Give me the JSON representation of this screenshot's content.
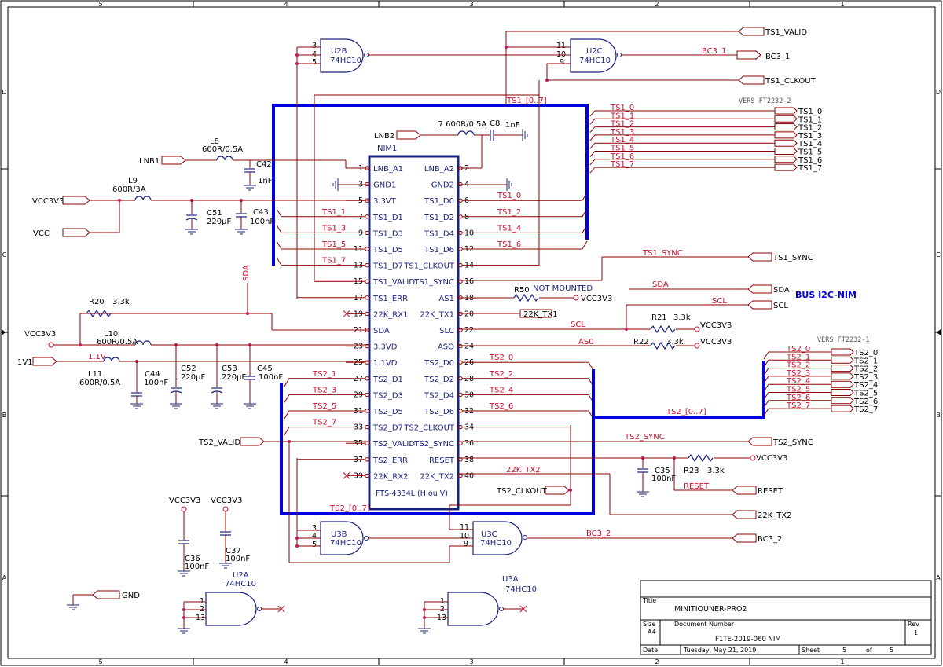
{
  "frame": {
    "cols": [
      "5",
      "4",
      "3",
      "2",
      "1"
    ],
    "rows": [
      "D",
      "C",
      "B",
      "A"
    ]
  },
  "title_block": {
    "title_label": "Title",
    "title": "MINITIOUNER-PRO2",
    "size_label": "Size",
    "size": "A4",
    "docnum_label": "Document Number",
    "docnum": "F1TE-2019-060   NIM",
    "rev_label": "Rev",
    "rev": "1",
    "date_label": "Date:",
    "date": "Tuesday, May 21, 2019",
    "sheet_label": "Sheet",
    "sheet": "5",
    "of_label": "of",
    "sheets": "5"
  },
  "nim": {
    "refdes": "NIM1",
    "part": "FTS-4334L (H ou V)",
    "left_pins": [
      {
        "num": "1",
        "name": "LNB_A1"
      },
      {
        "num": "3",
        "name": "GND1"
      },
      {
        "num": "5",
        "name": "3.3VT"
      },
      {
        "num": "7",
        "name": "TS1_D1"
      },
      {
        "num": "9",
        "name": "TS1_D3"
      },
      {
        "num": "11",
        "name": "TS1_D5"
      },
      {
        "num": "13",
        "name": "TS1_D7"
      },
      {
        "num": "15",
        "name": "TS1_VALID"
      },
      {
        "num": "17",
        "name": "TS1_ERR"
      },
      {
        "num": "19",
        "name": "22K_RX1"
      },
      {
        "num": "21",
        "name": "SDA"
      },
      {
        "num": "23",
        "name": "3.3VD"
      },
      {
        "num": "25",
        "name": "1.1VD"
      },
      {
        "num": "27",
        "name": "TS2_D1"
      },
      {
        "num": "29",
        "name": "TS2_D3"
      },
      {
        "num": "31",
        "name": "TS2_D5"
      },
      {
        "num": "33",
        "name": "TS2_D7"
      },
      {
        "num": "35",
        "name": "TS2_VALID"
      },
      {
        "num": "37",
        "name": "TS2_ERR"
      },
      {
        "num": "39",
        "name": "22K_RX2"
      }
    ],
    "right_pins": [
      {
        "num": "2",
        "name": "LNB_A2"
      },
      {
        "num": "4",
        "name": "GND2"
      },
      {
        "num": "6",
        "name": "TS1_D0"
      },
      {
        "num": "8",
        "name": "TS1_D2"
      },
      {
        "num": "10",
        "name": "TS1_D4"
      },
      {
        "num": "12",
        "name": "TS1_D6"
      },
      {
        "num": "14",
        "name": "TS1_CLKOUT"
      },
      {
        "num": "16",
        "name": "TS1_SYNC"
      },
      {
        "num": "18",
        "name": "AS1"
      },
      {
        "num": "20",
        "name": "22K_TX1"
      },
      {
        "num": "22",
        "name": "SLC"
      },
      {
        "num": "24",
        "name": "ASO"
      },
      {
        "num": "26",
        "name": "TS2_D0"
      },
      {
        "num": "28",
        "name": "TS2_D2"
      },
      {
        "num": "30",
        "name": "TS2_D4"
      },
      {
        "num": "32",
        "name": "TS2_D6"
      },
      {
        "num": "34",
        "name": "TS2_CLKOUT"
      },
      {
        "num": "36",
        "name": "TS2_SYNC"
      },
      {
        "num": "38",
        "name": "RESET"
      },
      {
        "num": "40",
        "name": "22K_TX2"
      }
    ],
    "left_nets": [
      "",
      "",
      "",
      "TS1_1",
      "TS1_3",
      "TS1_5",
      "TS1_7",
      "",
      "",
      "",
      "",
      "",
      "1.1V",
      "TS2_1",
      "TS2_3",
      "TS2_5",
      "TS2_7",
      "",
      "",
      ""
    ],
    "right_nets": [
      "",
      "",
      "TS1_0",
      "TS1_2",
      "TS1_4",
      "TS1_6",
      "",
      "",
      "",
      "",
      "",
      "",
      "TS2_0",
      "TS2_2",
      "TS2_4",
      "TS2_6",
      "",
      "",
      "",
      ""
    ]
  },
  "gates": {
    "u2b": {
      "ref": "U2B",
      "part": "74HC10",
      "pins": [
        "3",
        "4",
        "5"
      ],
      "out": "6"
    },
    "u2c": {
      "ref": "U2C",
      "part": "74HC10",
      "pins": [
        "11",
        "10",
        "9"
      ],
      "out": "8"
    },
    "u3b": {
      "ref": "U3B",
      "part": "74HC10",
      "pins": [
        "3",
        "4",
        "5"
      ],
      "out": "6"
    },
    "u3c": {
      "ref": "U3C",
      "part": "74HC10",
      "pins": [
        "11",
        "10",
        "9"
      ],
      "out": "8"
    },
    "u2a": {
      "ref": "U2A",
      "part": "74HC10",
      "pins": [
        "1",
        "2",
        "13"
      ],
      "out": "12"
    },
    "u3a": {
      "ref": "U3A",
      "part": "74HC10",
      "pins": [
        "1",
        "2",
        "13"
      ],
      "out": "12"
    }
  },
  "components": {
    "l7": "L7 600R/0.5A",
    "c8": "C8",
    "c8_val": "1nF",
    "l8": "L8",
    "l8_val": "600R/0.5A",
    "c42": "C42",
    "c42_val": "1nF",
    "l9": "L9",
    "l9_val": "600R/3A",
    "c51": "C51",
    "c51_val": "220µF",
    "c43": "C43",
    "c43_val": "100nF",
    "r20": "R20",
    "r20_val": "3.3k",
    "l10": "L10",
    "l10_val": "600R/0.5A",
    "l11": "L11",
    "l11_val": "600R/0.5A",
    "c44": "C44",
    "c44_val": "100nF",
    "c52": "C52",
    "c52_val": "220µF",
    "c53": "C53",
    "c53_val": "220µF",
    "c45": "C45",
    "c45_val": "100nF",
    "r50": "R50",
    "r50_note": "NOT MOUNTED",
    "r21": "R21",
    "r21_val": "3.3k",
    "r22": "R22",
    "r22_val": "3.3k",
    "r23": "R23",
    "r23_val": "3.3k",
    "c35": "C35",
    "c35_val": "100nF",
    "c36": "C36",
    "c36_val": "100nF",
    "c37": "C37",
    "c37_val": "100nF"
  },
  "ports": {
    "lnb1": "LNB1",
    "lnb2": "LNB2",
    "vcc3v3": "VCC3V3",
    "vcc": "VCC",
    "one_v1": "1V1",
    "ts2_valid": "TS2_VALID",
    "gnd": "GND",
    "ts1_valid": "TS1_VALID",
    "bc3_1": "BC3_1",
    "ts1_clkout": "TS1_CLKOUT",
    "ts1_sync": "TS1_SYNC",
    "sda": "SDA",
    "scl": "SCL",
    "ts2_sync": "TS2_SYNC",
    "reset": "RESET",
    "ts2_clkout": "TS2_CLKOUT",
    "k22_tx2": "22K_TX2",
    "k22_tx1": "22K_TX1",
    "bc3_2": "BC3_2",
    "vcc3v3_a": "VCC3V3",
    "vcc3v3_b": "VCC3V3",
    "vcc3v3_c": "VCC3V3",
    "vcc3v3_d": "VCC3V3",
    "vcc3v3_e": "VCC3V3",
    "vcc3v3_f": "VCC3V3"
  },
  "nets": {
    "ts1_bus": "TS1_[0..7]",
    "ts2_bus": "TS2_[0..7]",
    "ts2_bus_r": "TS2_[0..7]",
    "ts1_sync": "TS1_SYNC",
    "sda": "SDA",
    "scl": "SCL",
    "scl2": "SCL",
    "as0": "AS0",
    "ts2_sync": "TS2_SYNC",
    "reset": "RESET",
    "k22_tx2": "22K_TX2",
    "bc3_1": "BC3_1",
    "bc3_2": "BC3_2",
    "bus_nim": "BUS I2C-NIM",
    "vers2": "VERS FT2232-2",
    "vers1": "VERS FT2232-1"
  },
  "ts1_right": {
    "nets": [
      "TS1_0",
      "TS1_1",
      "TS1_2",
      "TS1_3",
      "TS1_4",
      "TS1_5",
      "TS1_6",
      "TS1_7"
    ],
    "ports": [
      "TS1_0",
      "TS1_1",
      "TS1_2",
      "TS1_3",
      "TS1_4",
      "TS1_5",
      "TS1_6",
      "TS1_7"
    ]
  },
  "ts2_right": {
    "nets": [
      "TS2_0",
      "TS2_1",
      "TS2_2",
      "TS2_3",
      "TS2_4",
      "TS2_5",
      "TS2_6",
      "TS2_7"
    ],
    "ports": [
      "TS2_0",
      "TS2_1",
      "TS2_2",
      "TS2_3",
      "TS2_4",
      "TS2_5",
      "TS2_6",
      "TS2_7"
    ]
  }
}
